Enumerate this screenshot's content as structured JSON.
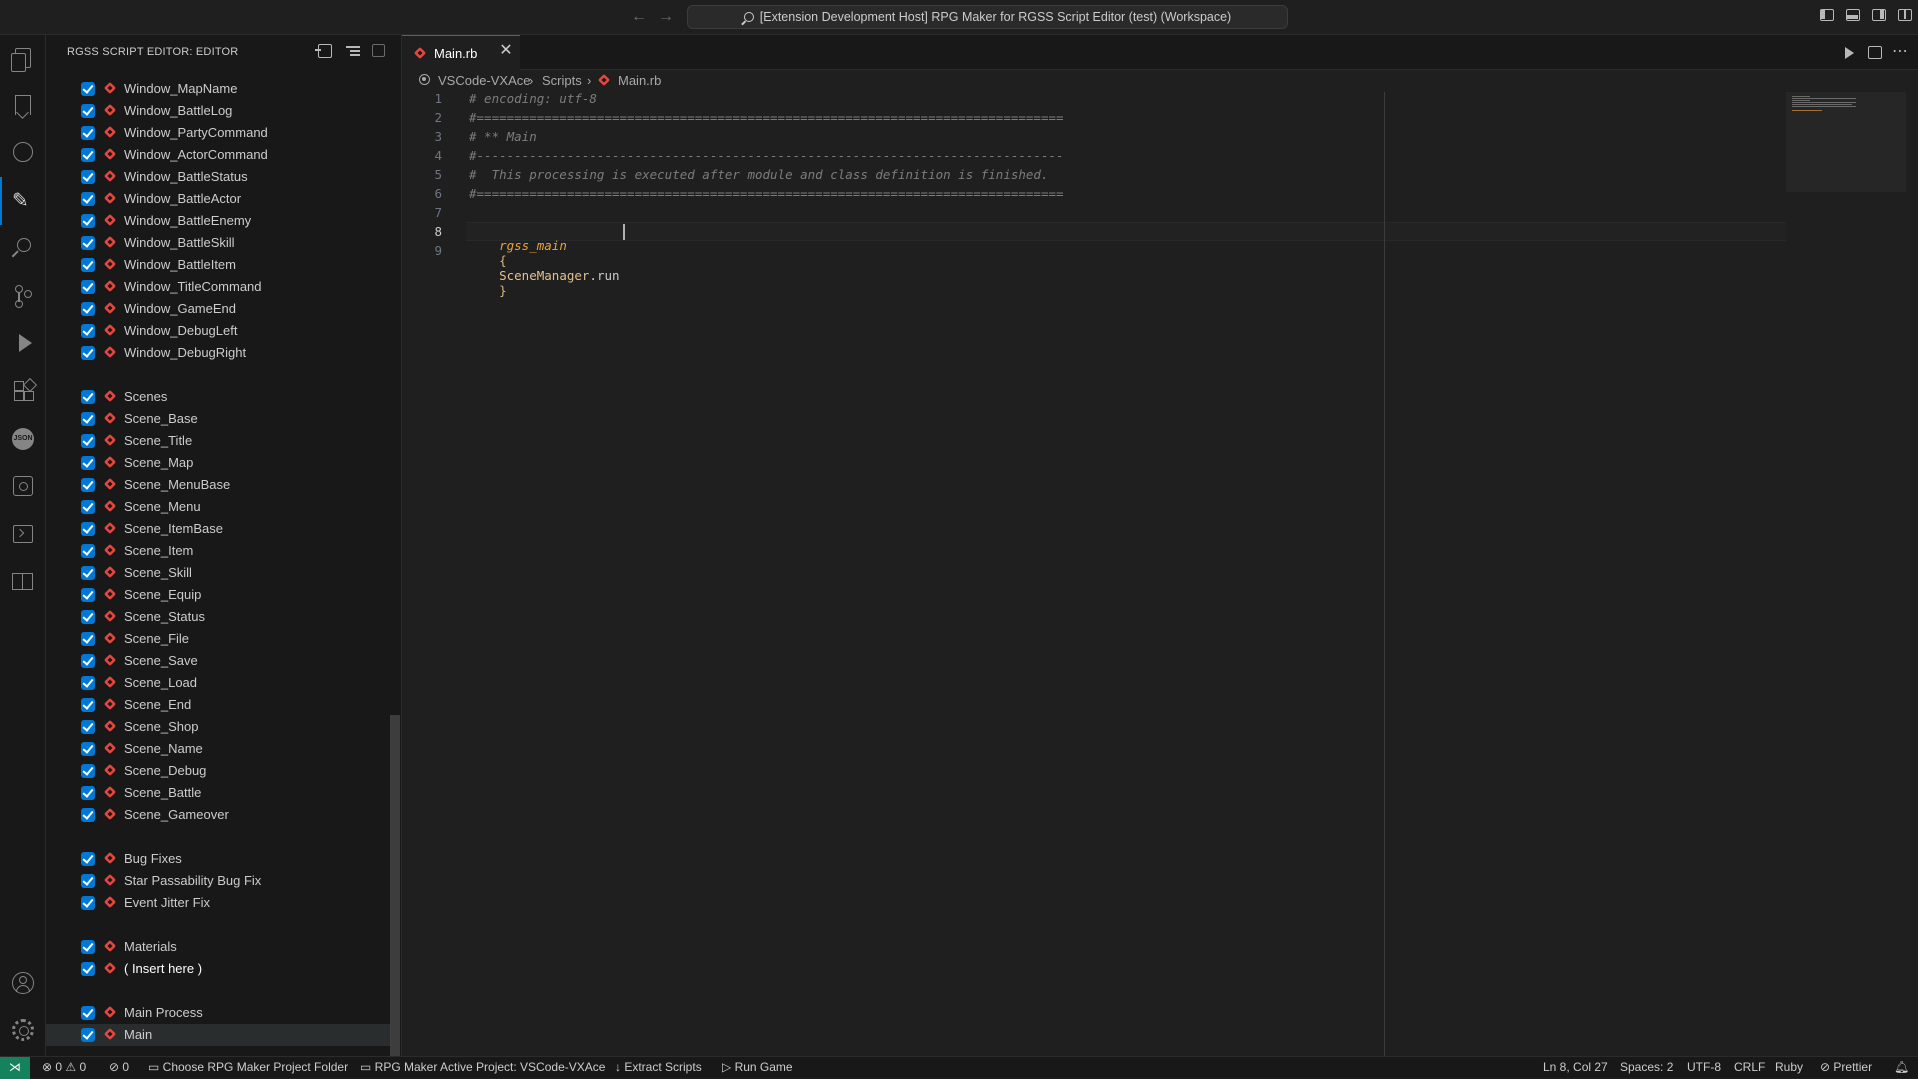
{
  "titlebar": {
    "title": "[Extension Development Host] RPG Maker for RGSS Script Editor (test) (Workspace)",
    "back_arrow": "←",
    "forward_arrow": "→"
  },
  "sidebar": {
    "title": "RGSS SCRIPT EDITOR: EDITOR",
    "items": [
      "Window_MapName",
      "Window_BattleLog",
      "Window_PartyCommand",
      "Window_ActorCommand",
      "Window_BattleStatus",
      "Window_BattleActor",
      "Window_BattleEnemy",
      "Window_BattleSkill",
      "Window_BattleItem",
      "Window_TitleCommand",
      "Window_GameEnd",
      "Window_DebugLeft",
      "Window_DebugRight",
      "",
      "Scenes",
      "Scene_Base",
      "Scene_Title",
      "Scene_Map",
      "Scene_MenuBase",
      "Scene_Menu",
      "Scene_ItemBase",
      "Scene_Item",
      "Scene_Skill",
      "Scene_Equip",
      "Scene_Status",
      "Scene_File",
      "Scene_Save",
      "Scene_Load",
      "Scene_End",
      "Scene_Shop",
      "Scene_Name",
      "Scene_Debug",
      "Scene_Battle",
      "Scene_Gameover",
      "",
      "Bug Fixes",
      "Star Passability Bug Fix",
      "Event Jitter Fix",
      "",
      "Materials",
      "( Insert here )",
      "",
      "Main Process",
      "Main"
    ]
  },
  "editor": {
    "tab_label": "Main.rb",
    "tab_close": "✕",
    "breadcrumb": [
      "VSCode-VXAce",
      "Scripts",
      "Main.rb"
    ],
    "breadcrumb_sep": "›",
    "lines": [
      {
        "num": "1",
        "text": "# encoding: utf-8"
      },
      {
        "num": "2",
        "text": "#=============================================================================="
      },
      {
        "num": "3",
        "text": "# ** Main"
      },
      {
        "num": "4",
        "text": "#------------------------------------------------------------------------------"
      },
      {
        "num": "5",
        "text": "#  This processing is executed after module and class definition is finished."
      },
      {
        "num": "6",
        "text": "#=============================================================================="
      },
      {
        "num": "7",
        "text": ""
      },
      {
        "num": "8",
        "text": ""
      },
      {
        "num": "9",
        "text": ""
      }
    ],
    "line8": {
      "func": "rgss_main",
      "open": "{",
      "const": "SceneManager",
      "call": ".run",
      "close": "}"
    }
  },
  "statusbar": {
    "remote": "⋊",
    "problems": "⊗ 0 ⚠ 0",
    "ports": "⊘ 0",
    "choose_folder": "Choose RPG Maker Project Folder",
    "active_project": "RPG Maker Active Project: VSCode-VXAce",
    "extract": "Extract Scripts",
    "run": "Run Game",
    "cursor": "Ln 8, Col 27",
    "spaces": "Spaces: 2",
    "encoding": "UTF-8",
    "eol": "CRLF",
    "language": "Ruby",
    "prettier": "Prettier"
  }
}
